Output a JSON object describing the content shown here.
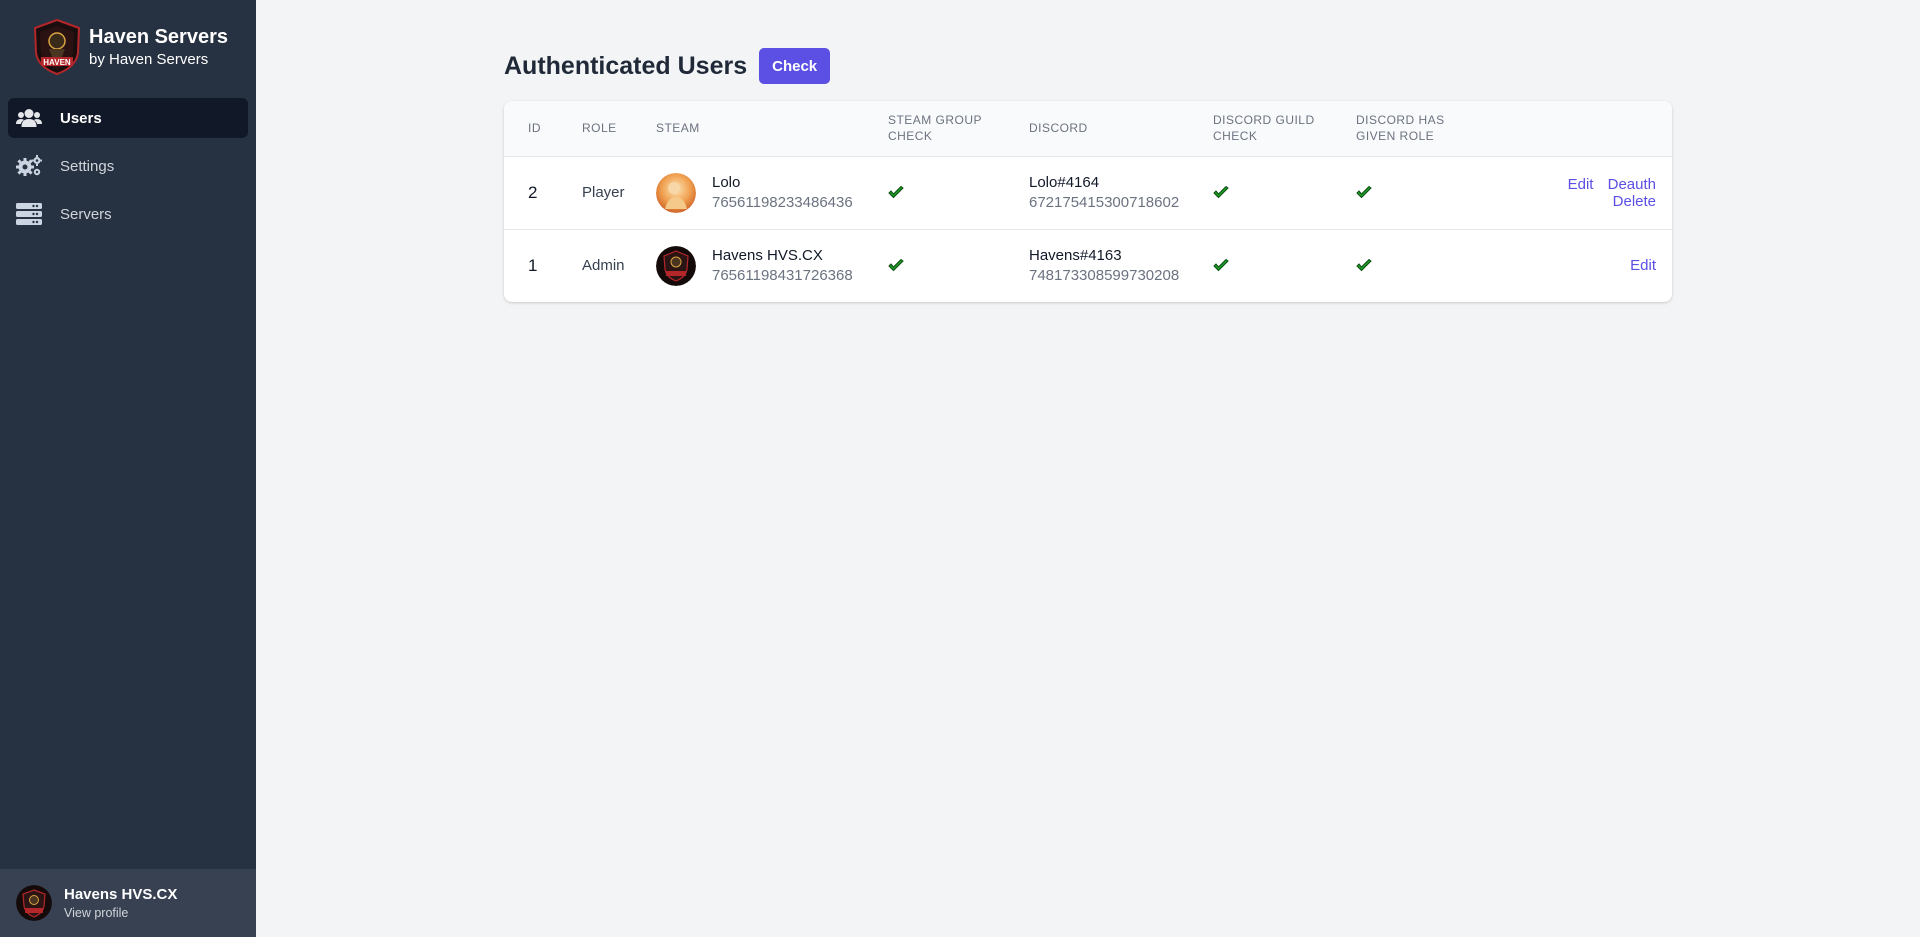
{
  "brand": {
    "title": "Haven Servers",
    "subtitle": "by Haven Servers"
  },
  "sidebar": {
    "items": [
      {
        "label": "Users",
        "icon": "users-icon",
        "active": true
      },
      {
        "label": "Settings",
        "icon": "gears-icon",
        "active": false
      },
      {
        "label": "Servers",
        "icon": "server-icon",
        "active": false
      }
    ]
  },
  "profile": {
    "name": "Havens HVS.CX",
    "link": "View profile"
  },
  "main": {
    "title": "Authenticated Users",
    "check_button": "Check"
  },
  "table": {
    "headers": {
      "id": "ID",
      "role": "Role",
      "steam": "Steam",
      "steam_group_check_1": "Steam Group",
      "steam_group_check_2": "Check",
      "discord": "Discord",
      "discord_guild_check_1": "Discord Guild",
      "discord_guild_check_2": "Check",
      "discord_has_given_role_1": "Discord Has",
      "discord_has_given_role_2": "Given Role"
    },
    "rows": [
      {
        "id": "2",
        "role": "Player",
        "steam_name": "Lolo",
        "steam_id": "76561198233486436",
        "steam_group_check": true,
        "discord_name": "Lolo#4164",
        "discord_id": "672175415300718602",
        "discord_guild_check": true,
        "discord_has_given_role": true,
        "actions": [
          "Edit",
          "Deauth",
          "Delete"
        ]
      },
      {
        "id": "1",
        "role": "Admin",
        "steam_name": "Havens HVS.CX",
        "steam_id": "76561198431726368",
        "steam_group_check": true,
        "discord_name": "Havens#4163",
        "discord_id": "748173308599730208",
        "discord_guild_check": true,
        "discord_has_given_role": true,
        "actions": [
          "Edit"
        ]
      }
    ]
  },
  "colors": {
    "sidebar": "#263141",
    "sidebar_active": "#111827",
    "profile_bar": "#374151",
    "accent": "#5b4fe4",
    "check_green": "#1e9e28",
    "page_bg": "#f3f4f6"
  }
}
